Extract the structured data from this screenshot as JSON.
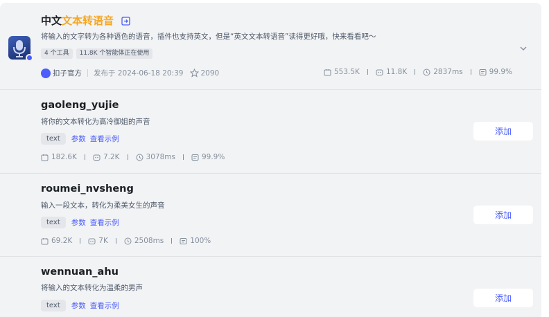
{
  "plugin": {
    "title_prefix": "中文",
    "title_highlight": "文本转语音",
    "description": "将输入的文字转为各种语色的语音，插件也支持英文，但是“英文文本转语音”读得更好哦，快来看看吧～",
    "tags": [
      "4 个工具",
      "11.8K 个智能体正在使用"
    ],
    "author": "扣子官方",
    "published": "发布于 2024-06-18 20:39",
    "stars": "2090",
    "stats": {
      "calls": "553.5K",
      "bots": "11.8K",
      "latency": "2837ms",
      "success": "99.9%"
    }
  },
  "tools": [
    {
      "name": "gaoleng_yujie",
      "description": "将你的文本转化为高冷御姐的声音",
      "param_tag": "text",
      "params_link": "参数",
      "example_link": "查看示例",
      "calls": "182.6K",
      "bots": "7.2K",
      "latency": "3078ms",
      "success": "99.9%",
      "add_label": "添加"
    },
    {
      "name": "roumei_nvsheng",
      "description": "输入一段文本，转化为柔美女生的声音",
      "param_tag": "text",
      "params_link": "参数",
      "example_link": "查看示例",
      "calls": "69.2K",
      "bots": "7K",
      "latency": "2508ms",
      "success": "100%",
      "add_label": "添加"
    },
    {
      "name": "wennuan_ahu",
      "description": "将输入的文本转化为温柔的男声",
      "param_tag": "text",
      "params_link": "参数",
      "example_link": "查看示例",
      "add_label": "添加"
    }
  ],
  "colors": {
    "accent": "#4b5dfa",
    "highlight": "#f5a623",
    "panel_bg": "#f2f3f5"
  }
}
